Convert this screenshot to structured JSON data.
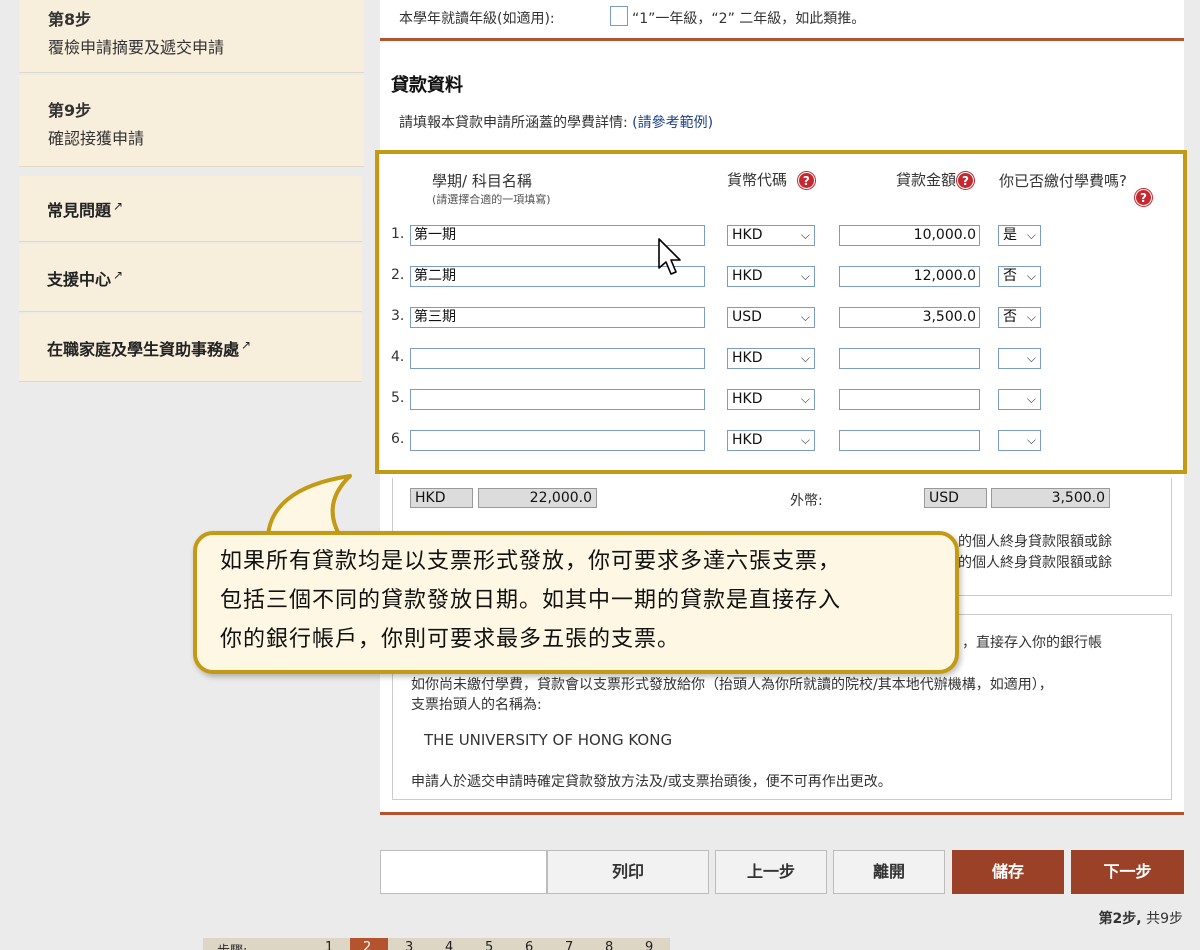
{
  "sidebar": {
    "step8_title": "第8步",
    "step8_desc": "覆檢申請摘要及遞交申請",
    "step9_title": "第9步",
    "step9_desc": "確認接獲申請",
    "links": [
      {
        "label": "常見問題"
      },
      {
        "label": "支援中心"
      },
      {
        "label": "在職家庭及學生資助事務處"
      }
    ],
    "external_icon": "↗"
  },
  "year_level": {
    "label": "本學年就讀年級(如適用):",
    "hint": "“1”一年級，“2” 二年級，如此類推。"
  },
  "loan_section": {
    "title": "貸款資料",
    "instruction": "請填報本貸款申請所涵蓋的學費詳情:",
    "example_link": "(請參考範例)",
    "col_term": "學期/ 科目名稱",
    "col_term_sub": "(請選擇合適的一項填寫)",
    "col_currency": "貨幣代碼",
    "col_amount": "貸款金額",
    "col_paid": "你已否繳付學費嗎?",
    "help_glyph": "?",
    "rows": [
      {
        "no": "1.",
        "term": "第一期",
        "currency": "HKD",
        "amount": "10,000.0",
        "paid": "是"
      },
      {
        "no": "2.",
        "term": "第二期",
        "currency": "HKD",
        "amount": "12,000.0",
        "paid": "否"
      },
      {
        "no": "3.",
        "term": "第三期",
        "currency": "USD",
        "amount": "3,500.0",
        "paid": "否"
      },
      {
        "no": "4.",
        "term": "",
        "currency": "HKD",
        "amount": "",
        "paid": ""
      },
      {
        "no": "5.",
        "term": "",
        "currency": "HKD",
        "amount": "",
        "paid": ""
      },
      {
        "no": "6.",
        "term": "",
        "currency": "HKD",
        "amount": "",
        "paid": ""
      }
    ]
  },
  "totals": {
    "local_currency": "HKD",
    "local_amount": "22,000.0",
    "foreign_label": "外幣:",
    "foreign_currency": "USD",
    "foreign_amount": "3,500.0"
  },
  "notes": {
    "limit_line1": "的個人終身貸款限額或餘",
    "limit_line2": "的個人終身貸款限額或餘",
    "deposit_partial": "，直接存入你的銀行帳",
    "cheque_note_line1": "如你尚未繳付學費，貸款會以支票形式發放給你（抬頭人為你所就讀的院校/其本地代辦機構，如適用），",
    "cheque_note_line2": "支票抬頭人的名稱為:",
    "payee": "THE UNIVERSITY OF HONG KONG",
    "final_note": "申請人於遞交申請時確定貸款發放方法及/或支票抬頭後，便不可再作出更改。"
  },
  "tooltip": {
    "line1": "如果所有貸款均是以支票形式發放，你可要求多達六張支票，",
    "line2": "包括三個不同的貸款發放日期。如其中一期的貸款是直接存入",
    "line3": "你的銀行帳戶，你則可要求最多五張的支票。"
  },
  "buttons": {
    "print": "列印",
    "prev": "上一步",
    "leave": "離開",
    "save": "儲存",
    "next": "下一步"
  },
  "step_status": {
    "current": "第2步,",
    "total": "共9步"
  },
  "pager": {
    "label": "步驟:",
    "steps": [
      "1",
      "2",
      "3",
      "4",
      "5",
      "6",
      "7",
      "8",
      "9"
    ],
    "active": "2"
  },
  "colors": {
    "accent": "#9a4128",
    "highlight": "#c49a14",
    "help": "#c6282f"
  }
}
